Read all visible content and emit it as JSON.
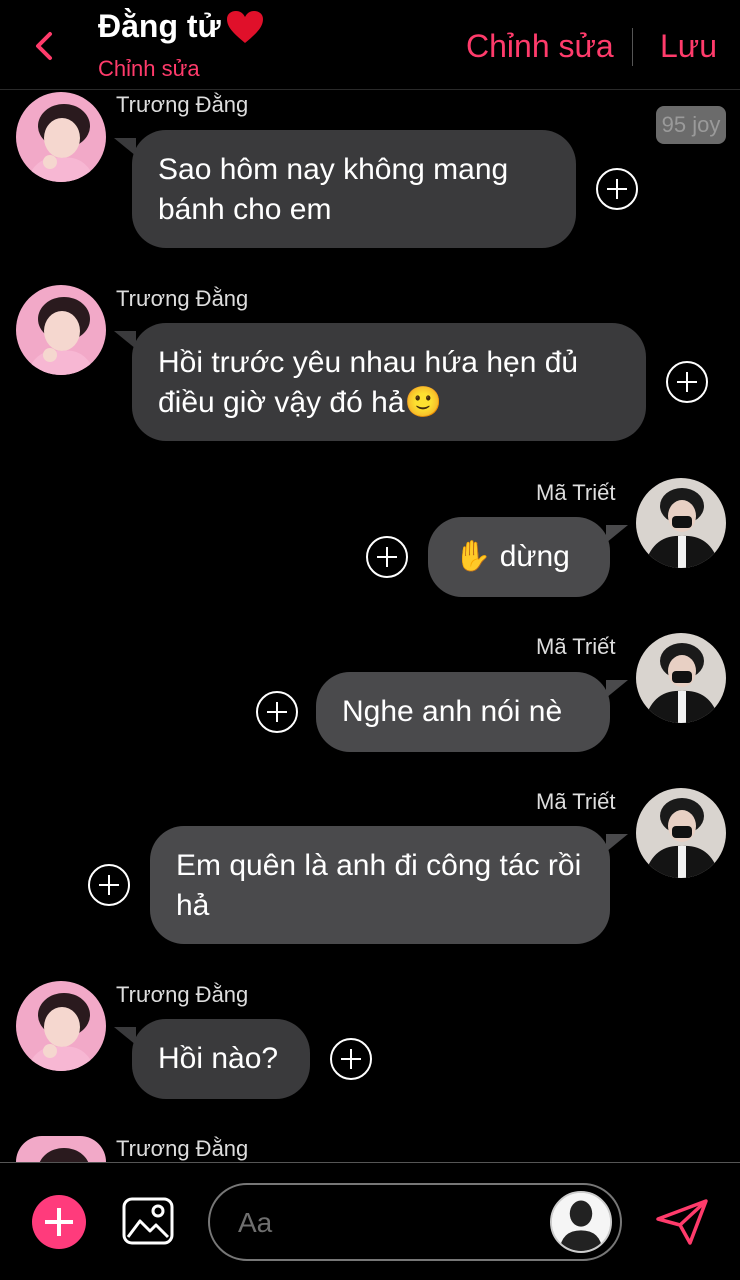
{
  "header": {
    "title": "Đằng tử",
    "subtitle": "Chỉnh sửa",
    "edit_label": "Chỉnh sửa",
    "save_label": "Lưu",
    "accent": "#ff3b6b"
  },
  "badge": "95 joy",
  "messages": [
    {
      "sender": "Trương Đằng",
      "text": "Sao hôm nay không mang bánh cho em",
      "side": "left"
    },
    {
      "sender": "Trương Đằng",
      "text": "Hồi trước yêu nhau hứa hẹn đủ điều giờ vậy đó hả🙂",
      "side": "left"
    },
    {
      "sender": "Mã Triết",
      "text": "✋ dừng",
      "side": "right"
    },
    {
      "sender": "Mã Triết",
      "text": "Nghe anh nói nè",
      "side": "right"
    },
    {
      "sender": "Mã Triết",
      "text": "Em quên là anh đi công tác rồi hả",
      "side": "right"
    },
    {
      "sender": "Trương Đằng",
      "text": "Hồi nào?",
      "side": "left"
    },
    {
      "sender": "Trương Đằng",
      "text": "",
      "side": "left"
    }
  ],
  "composer": {
    "placeholder": "Aa"
  },
  "icons": {
    "back": "chevron-left-icon",
    "heart": "heart-icon",
    "add": "plus-icon",
    "image": "image-icon",
    "send": "send-icon",
    "react": "add-reaction-icon"
  }
}
